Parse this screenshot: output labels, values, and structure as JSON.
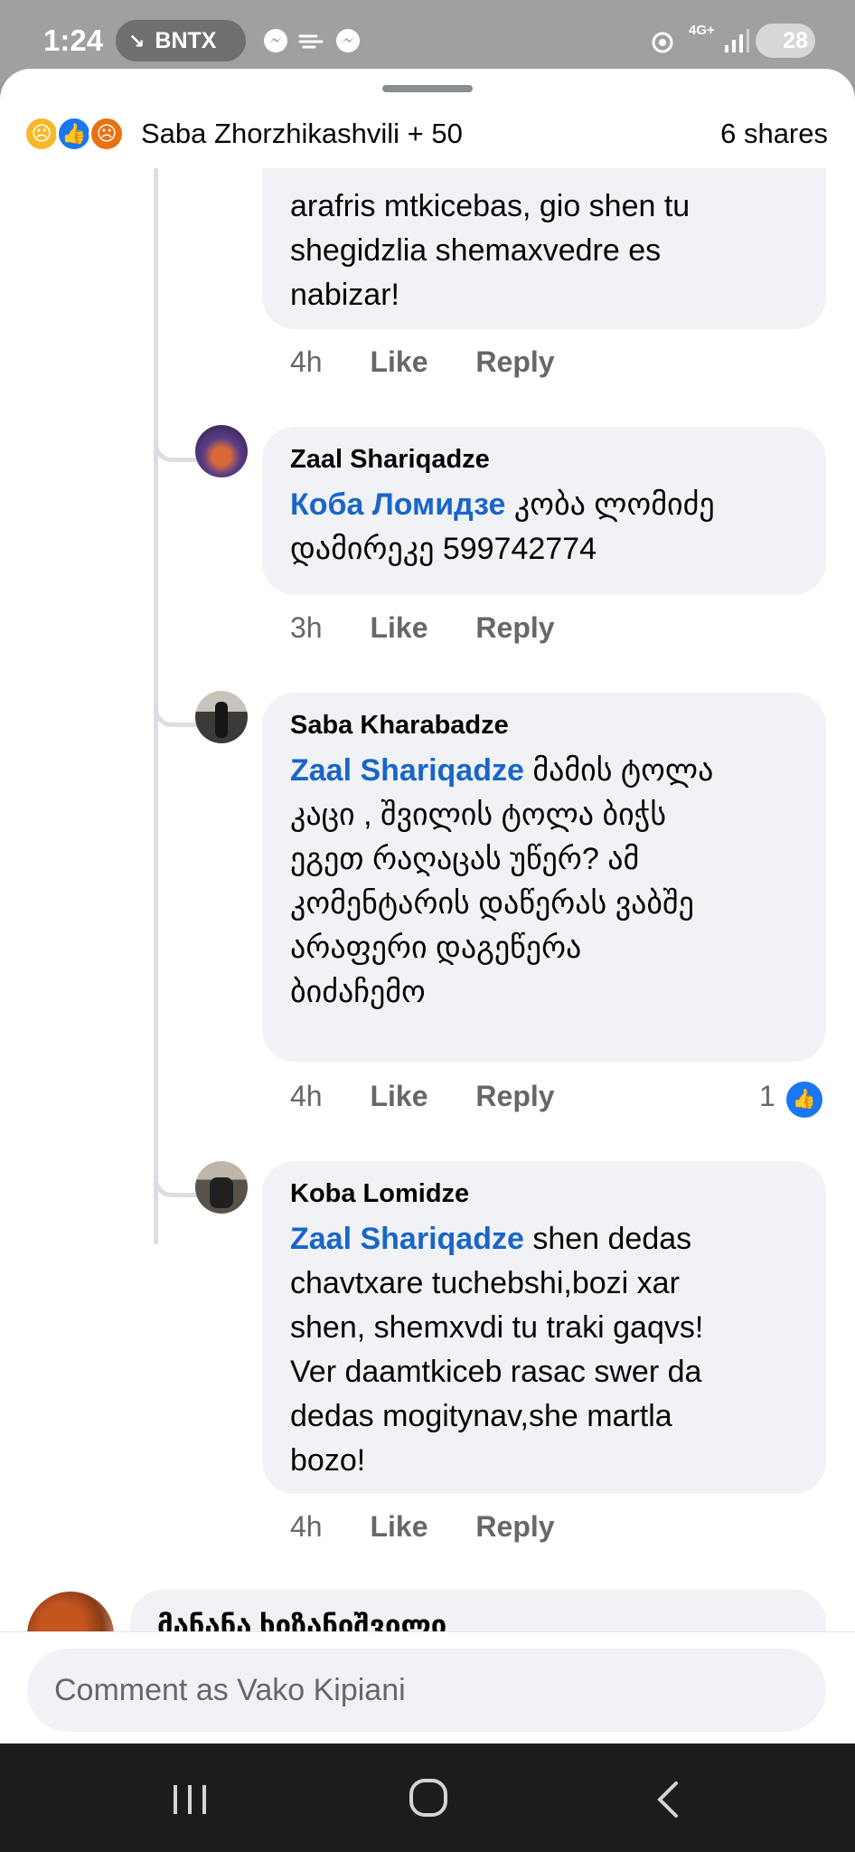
{
  "status_bar": {
    "time": "1:24",
    "ticker": "BNTX",
    "ticker_arrow": "↘",
    "network": "4G+",
    "battery": "28"
  },
  "header": {
    "reacted_by": "Saba Zhorzhikashvili + 50",
    "shares": "6 shares",
    "reactions": [
      "sad-reaction-icon",
      "like-reaction-icon",
      "angry-reaction-icon"
    ]
  },
  "comments": [
    {
      "text_lines": [
        "arafris mtkicebas, gio shen tu",
        "shegidzlia shemaxvedre es",
        "nabizar!"
      ],
      "time": "4h",
      "like_label": "Like",
      "reply_label": "Reply"
    },
    {
      "author": "Zaal Shariqadze",
      "mention": "Коба Ломидзе",
      "text_first": " კობა ლომიძე",
      "text_lines": [
        "დამირეკე 599742774"
      ],
      "time": "3h",
      "like_label": "Like",
      "reply_label": "Reply"
    },
    {
      "author": "Saba Kharabadze",
      "mention": "Zaal Shariqadze",
      "text_first": " მამის ტოლა",
      "text_lines": [
        "კაცი , შვილის ტოლა ბიჭს",
        "ეგეთ რაღაცას უწერ? ამ",
        "კომენტარის დაწერას ვაბშე",
        "არაფერი დაგეწერა",
        "ბიძაჩემო"
      ],
      "time": "4h",
      "like_label": "Like",
      "reply_label": "Reply",
      "like_count": "1"
    },
    {
      "author": "Koba  Lomidze",
      "mention": "Zaal Shariqadze",
      "text_first": " shen dedas",
      "text_lines": [
        "chavtxare tuchebshi,bozi xar",
        "shen, shemxvdi tu traki gaqvs!",
        "Ver daamtkiceb rasac swer da",
        "dedas mogitynav,she martla",
        "bozo!"
      ],
      "time": "4h",
      "like_label": "Like",
      "reply_label": "Reply"
    }
  ],
  "next_comment_author": "მანანა ხიზანიშვილი",
  "composer": {
    "placeholder": "Comment as Vako Kipiani"
  },
  "colors": {
    "accent": "#1877f2",
    "mention": "#1a65c8",
    "bubble": "#f0f2f5",
    "meta": "#65676b"
  }
}
